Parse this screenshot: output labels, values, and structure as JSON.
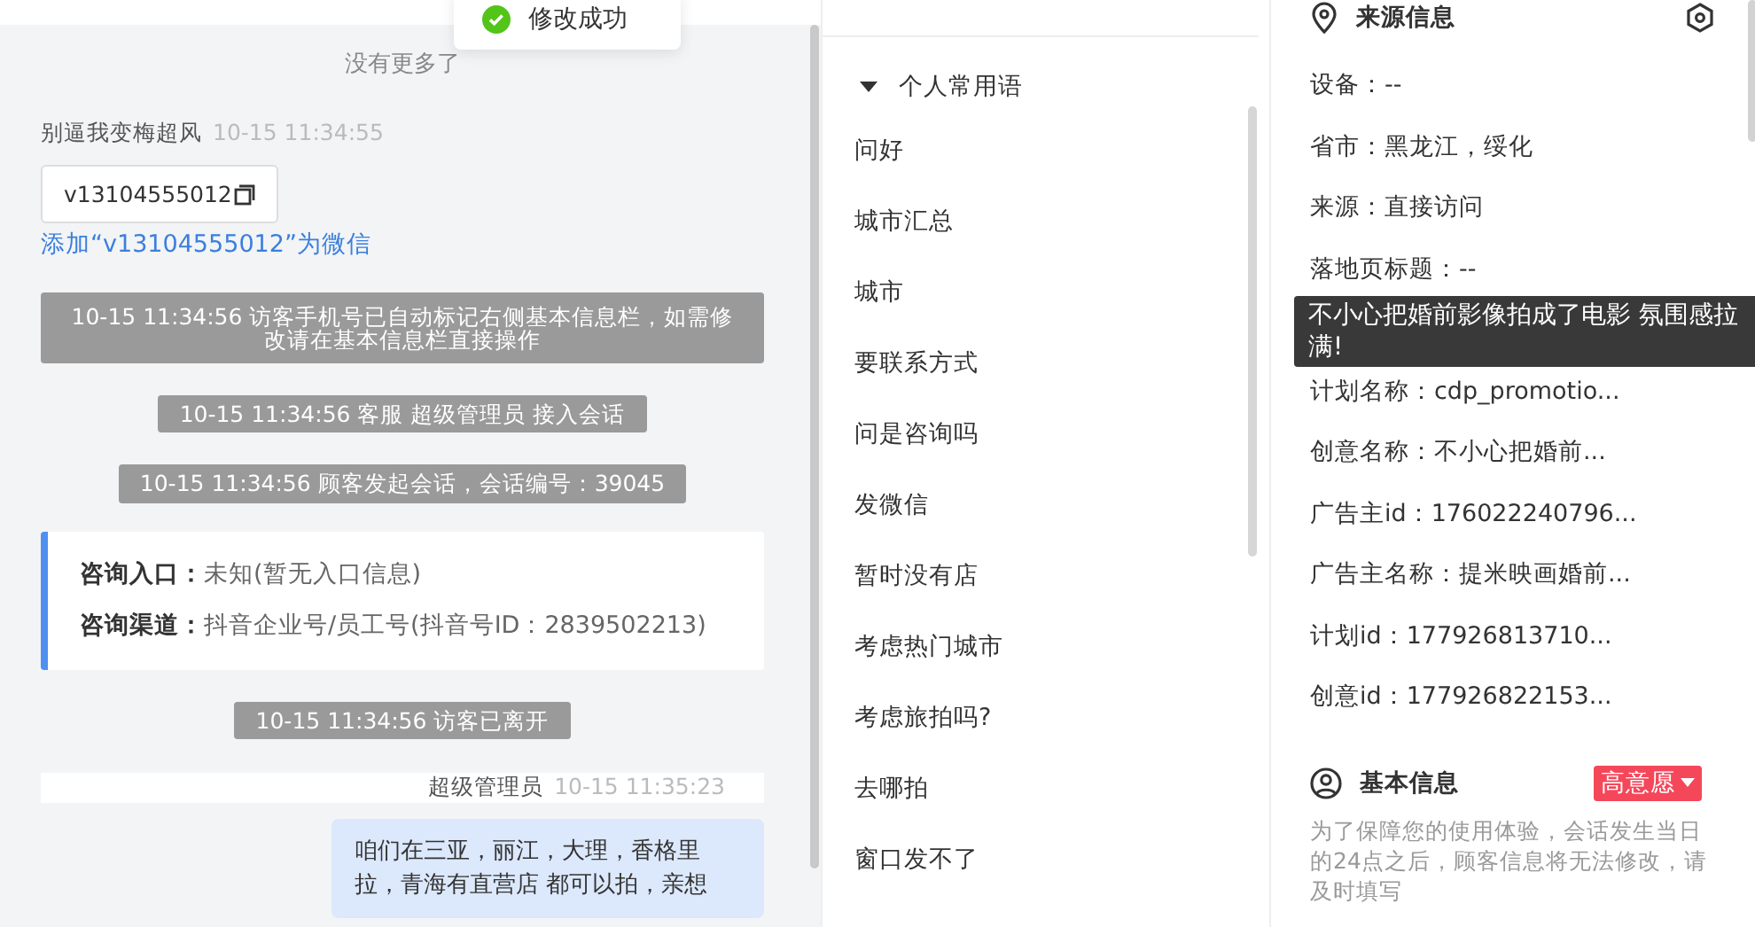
{
  "toast": {
    "text": "修改成功"
  },
  "chat": [
    {
      "kind": "notice",
      "text": "没有更多了"
    },
    {
      "kind": "visitor",
      "name": "别逼我变梅超风",
      "time": "10-15 11:34:55",
      "card": "v13104555012",
      "link": "添加“v13104555012”为微信"
    },
    {
      "kind": "system",
      "text": "10-15 11:34:56 访客手机号已自动标记右侧基本信息栏，如需修改请在基本信息栏直接操作"
    },
    {
      "kind": "system",
      "text": "10-15 11:34:56 客服 超级管理员 接入会话"
    },
    {
      "kind": "system",
      "text": "10-15 11:34:56 顾客发起会话，会话编号：39045"
    },
    {
      "kind": "entry",
      "lines": [
        {
          "label": "咨询入口：",
          "value": "未知(暂无入口信息)"
        },
        {
          "label": "咨询渠道：",
          "value": "抖音企业号/员工号(抖音号ID：2839502213)"
        }
      ]
    },
    {
      "kind": "system",
      "text": "10-15 11:34:56 访客已离开"
    },
    {
      "kind": "agent",
      "name": "超级管理员",
      "time": "10-15 11:35:23",
      "text": "咱们在三亚，丽江，大理，香格里拉，青海有直营店 都可以拍，亲想"
    }
  ],
  "phrases": {
    "group": "个人常用语",
    "expanded": true,
    "items": [
      "问好",
      "城市汇总",
      "城市",
      "要联系方式",
      "问是咨询吗",
      "发微信",
      "暂时没有店",
      "考虑热门城市",
      "考虑旅拍吗?",
      "去哪拍",
      "窗口发不了"
    ]
  },
  "source_info": {
    "title": "来源信息",
    "rows": [
      "设备：--",
      "省市：黑龙江，绥化",
      "来源：直接访问",
      "落地页标题：--",
      "",
      "计划名称：cdp_promotio...",
      "创意名称：不小心把婚前...",
      "广告主id：176022240796...",
      "广告主名称：提米映画婚前...",
      "计划id：177926813710...",
      "创意id：177926822153..."
    ],
    "tooltip": "不小心把婚前影像拍成了电影 氛围感拉满!"
  },
  "basic_info": {
    "title": "基本信息",
    "tag": "高意愿",
    "note": "为了保障您的使用体验，会话发生当日的24点之后，顾客信息将无法修改，请及时填写"
  }
}
